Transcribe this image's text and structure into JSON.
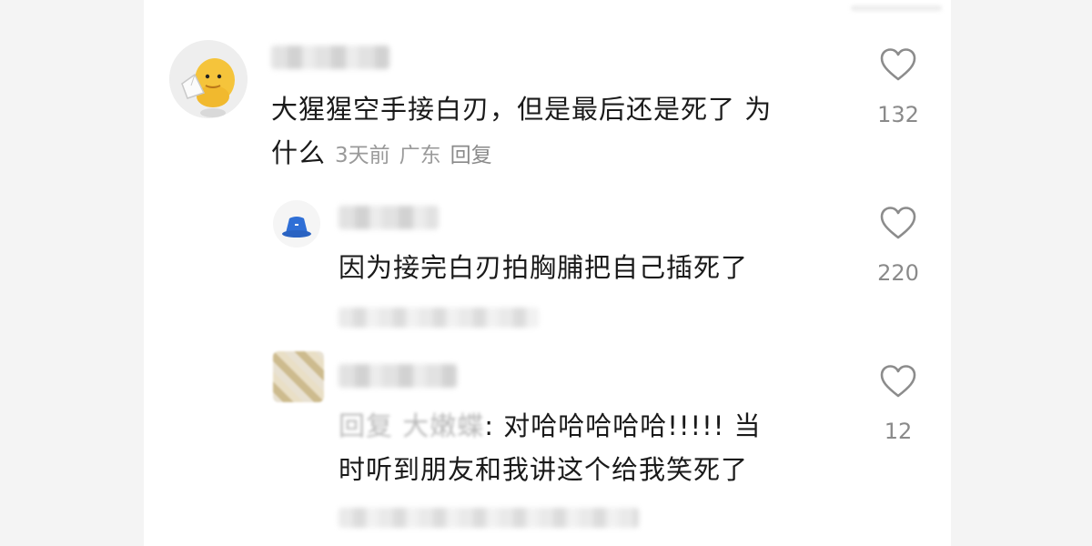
{
  "comments": [
    {
      "text_line1": "大猩猩空手接白刃，但是最后还是死了 为",
      "text_line2": "什么",
      "time": "3天前",
      "location": "广东",
      "reply_label": "回复",
      "likes": "132"
    },
    {
      "text": "因为接完白刃拍胸脯把自己插死了",
      "likes": "220"
    },
    {
      "reply_ref": "回复 大嫩蝶",
      "text_line1": ": 对哈哈哈哈哈!!!!!  当",
      "text_line2": "时听到朋友和我讲这个给我笑死了",
      "likes": "12"
    }
  ],
  "icons": {
    "like": "heart-outline-icon",
    "main_avatar": "cartoon-egg-avatar",
    "reply_avatar": "blue-hat-avatar"
  },
  "colors": {
    "text": "#1a1a1a",
    "meta": "#9a9a9a",
    "like_count": "#8a8a8a"
  }
}
